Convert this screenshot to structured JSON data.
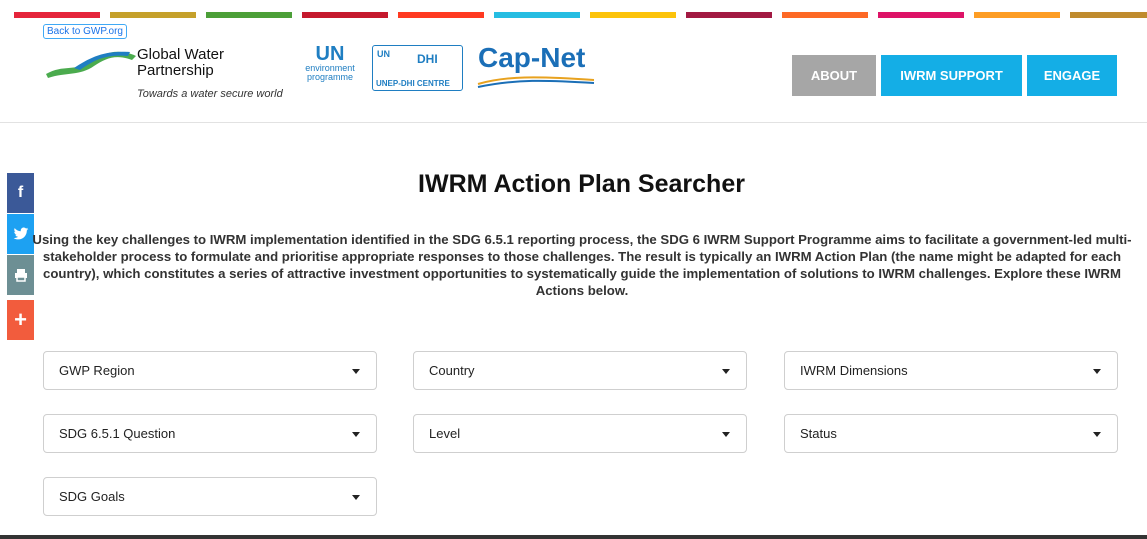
{
  "sdg_colors": [
    "#e5243b",
    "#c5a02a",
    "#4c9f38",
    "#c5192d",
    "#ff3a21",
    "#26bde2",
    "#fcc30b",
    "#a21942",
    "#fd6925",
    "#dd1367",
    "#fd9d24",
    "#bf8b2e"
  ],
  "header": {
    "back_link": "Back to GWP.org",
    "gwp_name_line1": "Global Water",
    "gwp_name_line2": "Partnership",
    "gwp_tagline": "Towards a water secure world",
    "unep": {
      "un": "UN",
      "line1": "environment",
      "line2": "programme"
    },
    "dhi": {
      "top": "UN",
      "mark": "DHI",
      "bottom": "UNEP-DHI CENTRE"
    },
    "capnet": "Cap-Net"
  },
  "nav": {
    "about": "ABOUT",
    "iwrm_support": "IWRM SUPPORT",
    "engage": "ENGAGE"
  },
  "share": {
    "facebook": "f",
    "twitter": "✉",
    "print": "⎙",
    "more": "+"
  },
  "main": {
    "title": "IWRM Action Plan Searcher",
    "intro": "Using the key challenges to IWRM implementation identified in the SDG 6.5.1 reporting process, the SDG 6 IWRM Support Programme aims to facilitate a government-led multi-stakeholder process to formulate and prioritise appropriate responses to those challenges. The result is typically an IWRM Action Plan (the name might be adapted for each country), which constitutes a series of attractive investment opportunities to systematically guide the implementation of solutions to IWRM challenges. Explore these IWRM Actions below."
  },
  "filters": {
    "gwp_region": "GWP Region",
    "country": "Country",
    "iwrm_dimensions": "IWRM Dimensions",
    "sdg_question": "SDG 6.5.1 Question",
    "level": "Level",
    "status": "Status",
    "sdg_goals": "SDG Goals"
  }
}
